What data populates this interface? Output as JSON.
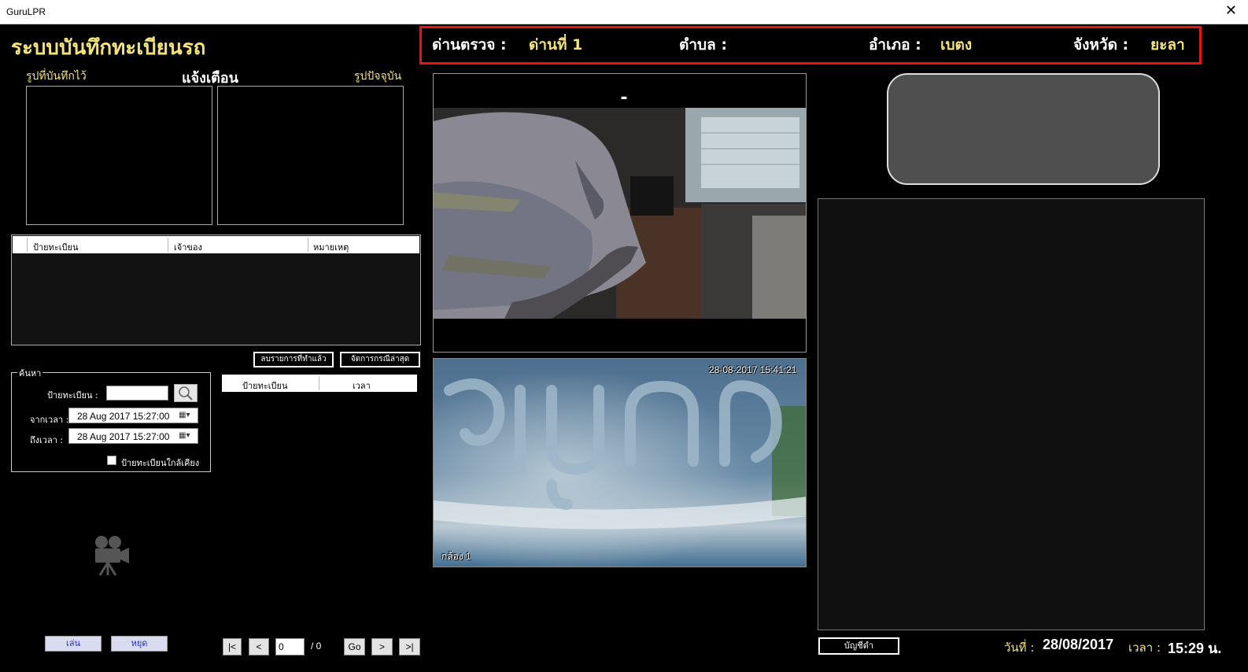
{
  "window": {
    "title": "GuruLPR",
    "close_icon": "close-icon"
  },
  "app": {
    "title": "ระบบบันทึกทะเบียนรถ"
  },
  "header": {
    "checkpoint_label": "ด่านตรวจ :",
    "checkpoint_value": "ด่านที่ 1",
    "subdistrict_label": "ตำบล :",
    "subdistrict_value": "",
    "district_label": "อำเภอ :",
    "district_value": "เบตง",
    "province_label": "จังหวัด :",
    "province_value": "ยะลา",
    "accent_color": "#f4e37b",
    "border_color": "#ee1111"
  },
  "alert": {
    "saved_image_label": "รูปที่บันทึกไว้",
    "alert_label": "แจ้งเตือน",
    "current_image_label": "รูปปัจจุบัน"
  },
  "alert_table": {
    "columns": [
      "ป้ายทะเบียน",
      "เจ้าของ",
      "หมายเหตุ"
    ],
    "rows": []
  },
  "actions": {
    "delete_done": "ลบรายการที่ทำแล้ว",
    "handle_latest": "จัดการกรณีล่าสุด"
  },
  "history_table": {
    "columns": [
      "ป้ายทะเบียน",
      "เวลา"
    ],
    "rows": []
  },
  "search": {
    "legend": "ค้นหา",
    "plate_label": "ป้ายทะเบียน :",
    "plate_value": "",
    "from_label": "จากเวลา :",
    "from_value": "28 Aug 2017   15:27:00",
    "to_label": "ถึงเวลา :",
    "to_value": "28 Aug 2017   15:27:00",
    "similar_label": "ป้ายทะเบียนใกล้เคียง",
    "similar_checked": false,
    "search_icon": "magnifier-icon"
  },
  "player": {
    "camera_icon": "movie-camera-icon",
    "play": "เล่น",
    "stop": "หยุด"
  },
  "pagination": {
    "first": "|<",
    "prev": "<",
    "page": "0",
    "total": "/ 0",
    "go": "Go",
    "next": ">",
    "last": ">|"
  },
  "camera": {
    "timestamp": "28-08-2017 15:41:21",
    "name": "กล้อง 1"
  },
  "plate": {
    "value": "-"
  },
  "footer": {
    "blacklist": "บัญชีดำ",
    "date_label": "วันที่ :",
    "date_value": "28/08/2017",
    "time_label": "เวลา :",
    "time_value": "15:29 น."
  }
}
